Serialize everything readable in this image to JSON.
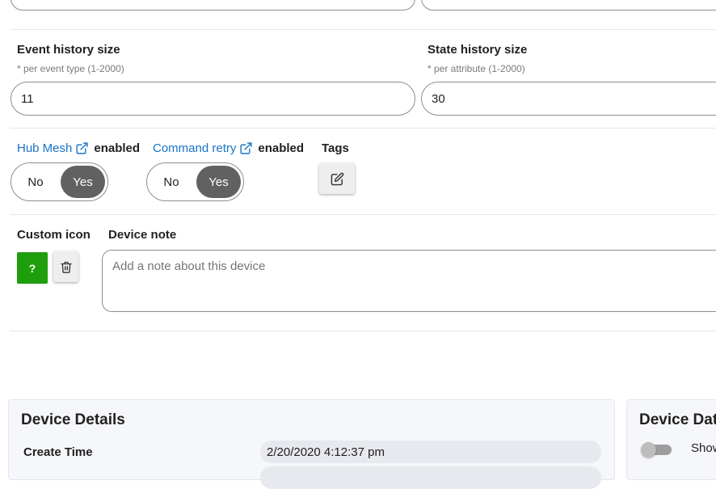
{
  "event_history": {
    "label": "Event history size",
    "hint": "* per event type (1-2000)",
    "value": "11"
  },
  "state_history": {
    "label": "State history size",
    "hint": "* per attribute (1-2000)",
    "value": "30"
  },
  "hub_mesh": {
    "link_label": "Hub Mesh",
    "suffix": "enabled",
    "no_label": "No",
    "yes_label": "Yes",
    "selected": "Yes"
  },
  "command_retry": {
    "link_label": "Command retry",
    "suffix": "enabled",
    "no_label": "No",
    "yes_label": "Yes",
    "selected": "Yes"
  },
  "tags": {
    "label": "Tags",
    "edit_icon": "edit-icon"
  },
  "custom_icon": {
    "label": "Custom icon",
    "glyph": "?",
    "color": "#1e9e0c",
    "delete_icon": "trash-icon"
  },
  "device_note": {
    "label": "Device note",
    "placeholder": "Add a note about this device"
  },
  "device_details": {
    "title": "Device Details",
    "rows": [
      {
        "label": "Create Time",
        "value": "2/20/2020 4:12:37 pm"
      }
    ]
  },
  "device_data": {
    "title": "Device Data",
    "toggle_label": "Show",
    "toggle_on": false
  },
  "colors": {
    "link": "#1a73c8",
    "toggle_selected": "#616161",
    "card_bg": "#f6f7fa"
  }
}
